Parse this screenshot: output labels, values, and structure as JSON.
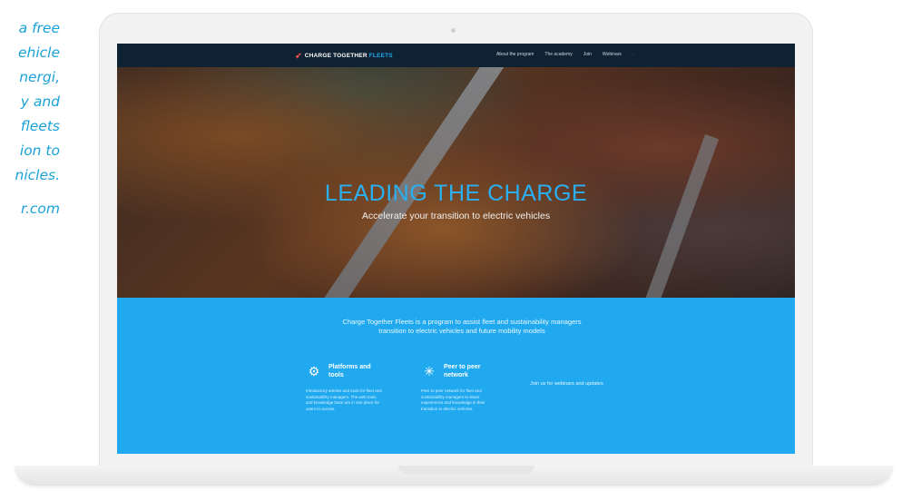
{
  "caption": {
    "lines": [
      "a free",
      "ehicle",
      "nergi,",
      "y and",
      "fleets",
      "ion to",
      "nicles."
    ],
    "url": "r.com"
  },
  "site": {
    "logo": {
      "name": "CHARGE TOGETHER",
      "accent": "FLEETS"
    },
    "menu": [
      "About the program",
      "The academy",
      "Join",
      "Webinars"
    ],
    "hero": {
      "title": "LEADING THE CHARGE",
      "subtitle": "Accelerate your transition to electric vehicles"
    },
    "intro": "Charge Together Fleets is a program to assist fleet and sustainability managers transition to electric vehicles and future mobility models",
    "features": [
      {
        "title": "Platforms and tools",
        "icon": "tools-icon",
        "desc": "Introductory articles and tools for fleet and sustainability managers. The web tools and knowledge base are in one place for users to access."
      },
      {
        "title": "Peer to peer network",
        "icon": "network-icon",
        "desc": "Peer to peer network for fleet and sustainability managers to share experiences and knowledge in their transition to electric vehicles."
      }
    ],
    "join_text": "Join us for webinars and updates"
  },
  "colors": {
    "caption": "#1aa2d6",
    "nav_bg": "#0e2233",
    "brand_blue": "#21a9ef",
    "logo_mark": "#ff4f4f"
  }
}
